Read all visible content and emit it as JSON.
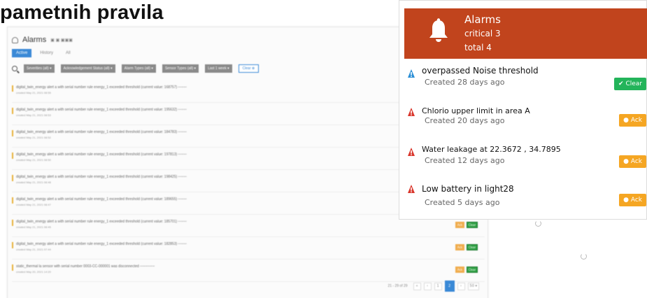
{
  "heading": "pametnih pravila",
  "background_list": {
    "title": "Alarms",
    "subtitle": "▣ ▣ ▣▣▣",
    "tabs": [
      "Active",
      "History",
      "All"
    ],
    "filters": [
      "Severities (all) ▾",
      "Acknowledgement Status (all) ▾",
      "Alarm Types (all) ▾",
      "Sensor Types (all) ▾",
      "Last 1 week ▾"
    ],
    "clear_label": "Clear ⊗",
    "rows": [
      {
        "text": "digital_twin_energy alert a with serial number rule energy_1 exceeded threshold (current value: 168757) ▫▫▫▫▫▫▫",
        "sub": "created May 21, 2021 08:55"
      },
      {
        "text": "digital_twin_energy alert a with serial number rule energy_1 exceeded threshold (current value: 195632) ▫▫▫▫▫▫▫",
        "sub": "created May 21, 2021 08:53"
      },
      {
        "text": "digital_twin_energy alert a with serial number rule energy_1 exceeded threshold (current value: 184783) ▫▫▫▫▫▫▫",
        "sub": "created May 21, 2021 08:52"
      },
      {
        "text": "digital_twin_energy alert a with serial number rule energy_1 exceeded threshold (current value: 197813) ▫▫▫▫▫▫▫",
        "sub": "created May 21, 2021 08:50"
      },
      {
        "text": "digital_twin_energy alert a with serial number rule energy_1 exceeded threshold (current value: 198425) ▫▫▫▫▫▫▫",
        "sub": "created May 21, 2021 08:48"
      },
      {
        "text": "digital_twin_energy alert a with serial number rule energy_1 exceeded threshold (current value: 189655) ▫▫▫▫▫▫▫",
        "sub": "created May 21, 2021 08:47"
      },
      {
        "text": "digital_twin_energy alert a with serial number rule energy_1 exceeded threshold (current value: 185701) ▫▫▫▫▫▫▫",
        "sub": "created May 21, 2021 08:45"
      },
      {
        "text": "digital_twin_energy alert a with serial number rule energy_1 exceeded threshold (current value: 182853) ▫▫▫▫▫▫▫",
        "sub": "created May 21, 2021 07:44"
      },
      {
        "text": "static_thermal la sensor with serial number 0003-CC-000001 was disconnected ▫▫▫▫▫▫▫▫▫▫▫▫",
        "sub": "created May 20, 2021 14:20"
      }
    ],
    "row_ack_label": "Ack",
    "row_clear_label": "Clear",
    "pager_info": "21 - 29 of 29",
    "pages": [
      "«",
      "‹",
      "1",
      "2",
      "›",
      "50 ▾"
    ]
  },
  "widget": {
    "title": "Alarms",
    "critical": "critical 3",
    "total": "total 4",
    "colors": {
      "header": "#c1441d",
      "info": "#2b8fd6",
      "critical": "#d9362c",
      "ack": "#f5a623",
      "clear": "#23b45a"
    },
    "alarms": [
      {
        "title": "overpassed Noise threshold",
        "created": "Created 28 days ago",
        "severity": "info",
        "action": "✔ Clear"
      },
      {
        "title": "Chlorio upper limit in area A",
        "created": "Created 20 days ago",
        "severity": "critical",
        "action": "● Ack"
      },
      {
        "title": "Water leakage at 22.3672 , 34.7895",
        "created": "Created 12 days ago",
        "severity": "critical",
        "action": "● Ack"
      },
      {
        "title": "Low battery in light28",
        "created": "Created 5 days ago",
        "severity": "critical",
        "action": "● Ack"
      }
    ]
  }
}
